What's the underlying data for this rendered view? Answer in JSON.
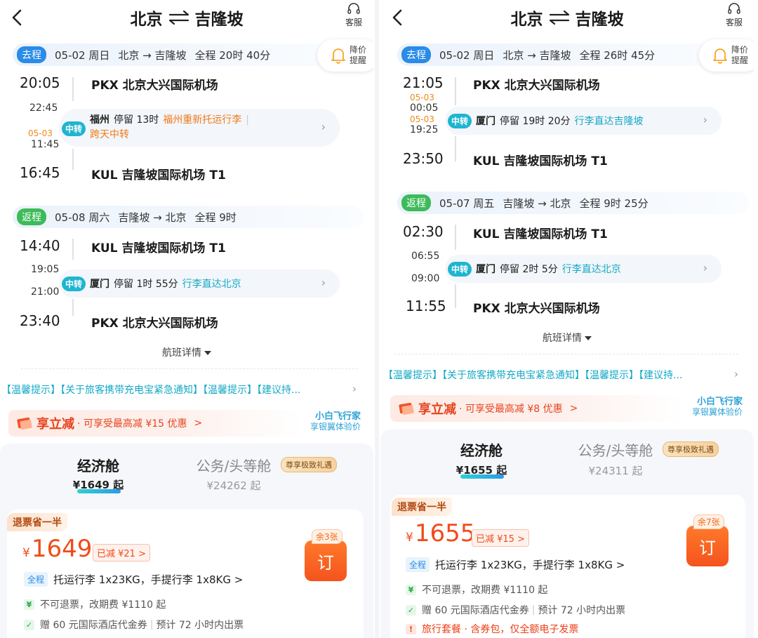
{
  "left": {
    "title": {
      "from": "北京",
      "to": "吉隆坡"
    },
    "service_label": "客服",
    "alert_label_1": "降价",
    "alert_label_2": "提醒",
    "outbound": {
      "tag": "去程",
      "date": "05-02 周日",
      "route": "北京 → 吉隆坡",
      "duration": "全程 20时 40分",
      "dep_time": "20:05",
      "dep_airport": "PKX 北京大兴国际机场",
      "stop_arrive": "22:45",
      "stop_depart_date": "05-03",
      "stop_depart": "11:45",
      "transfer_badge": "中转",
      "stop_city": "福州",
      "stop_duration": "停留 13时",
      "stop_note": "福州重新托运行李",
      "stop_note2": "跨天中转",
      "arr_time": "16:45",
      "arr_airport": "KUL 吉隆坡国际机场 T1"
    },
    "return": {
      "tag": "返程",
      "date": "05-08 周六",
      "route": "吉隆坡 → 北京",
      "duration": "全程 9时",
      "dep_time": "14:40",
      "dep_airport": "KUL 吉隆坡国际机场 T1",
      "stop_arrive": "19:05",
      "stop_depart": "21:00",
      "transfer_badge": "中转",
      "stop_city": "厦门",
      "stop_duration": "停留 1时 55分",
      "stop_note": "行李直达北京",
      "arr_time": "23:40",
      "arr_airport": "PKX 北京大兴国际机场"
    },
    "details_link": "航班详情",
    "notice": "【温馨提示】【关于旅客携带充电宝紧急通知】【温馨提示】【建议持...",
    "promo": {
      "title": "享立减",
      "text": "· 可享受最高减 ¥15 优惠",
      "arrow": ">",
      "side1": "小白飞行家",
      "side2": "享银翼体验价"
    },
    "cabins": {
      "economy": "经济舱",
      "economy_price": "¥1649 起",
      "business": "公务/头等舱",
      "vip": "尊享极致礼遇",
      "business_price": "¥24262 起"
    },
    "offer": {
      "refund_tag": "退票省一半",
      "currency": "¥",
      "price": "1649",
      "discount": "已减 ¥21 >",
      "remain": "余3张",
      "book": "订",
      "baggage_tag": "全程",
      "baggage": "托运行李 1x23KG，手提行李 1x8KG >",
      "rule1": "不可退票，改期费 ¥1110 起",
      "rule2a": "赠 60 元国际酒店代金券",
      "rule2b": "预计 72 小时内出票"
    }
  },
  "right": {
    "title": {
      "from": "北京",
      "to": "吉隆坡"
    },
    "service_label": "客服",
    "alert_label_1": "降价",
    "alert_label_2": "提醒",
    "outbound": {
      "tag": "去程",
      "date": "05-02 周日",
      "route": "北京 → 吉隆坡",
      "duration": "全程 26时 45分",
      "dep_time": "21:05",
      "dep_airport": "PKX 北京大兴国际机场",
      "stop_arrive_date": "05-03",
      "stop_arrive": "00:05",
      "stop_depart_date": "05-03",
      "stop_depart": "19:25",
      "transfer_badge": "中转",
      "stop_city": "厦门",
      "stop_duration": "停留 19时 20分",
      "stop_note": "行李直达吉隆坡",
      "arr_time": "23:50",
      "arr_airport": "KUL 吉隆坡国际机场 T1"
    },
    "return": {
      "tag": "返程",
      "date": "05-07 周五",
      "route": "吉隆坡 → 北京",
      "duration": "全程 9时 25分",
      "dep_time": "02:30",
      "dep_airport": "KUL 吉隆坡国际机场 T1",
      "stop_arrive": "06:55",
      "stop_depart": "09:00",
      "transfer_badge": "中转",
      "stop_city": "厦门",
      "stop_duration": "停留 2时 5分",
      "stop_note": "行李直达北京",
      "arr_time": "11:55",
      "arr_airport": "PKX 北京大兴国际机场"
    },
    "details_link": "航班详情",
    "notice": "【温馨提示】【关于旅客携带充电宝紧急通知】【温馨提示】【建议持...",
    "promo": {
      "title": "享立减",
      "text": "· 可享受最高减 ¥8 优惠",
      "arrow": ">",
      "side1": "小白飞行家",
      "side2": "享银翼体验价"
    },
    "cabins": {
      "economy": "经济舱",
      "economy_price": "¥1655 起",
      "business": "公务/头等舱",
      "vip": "尊享极致礼遇",
      "business_price": "¥24311 起"
    },
    "offer": {
      "refund_tag": "退票省一半",
      "currency": "¥",
      "price": "1655",
      "discount": "已减 ¥15 >",
      "remain": "余7张",
      "book": "订",
      "baggage_tag": "全程",
      "baggage": "托运行李 1x23KG，手提行李 1x8KG >",
      "rule1": "不可退票，改期费 ¥1110 起",
      "rule2a": "赠 60 元国际酒店代金券",
      "rule2b": "预计 72 小时内出票",
      "rule3": "旅行套餐 · 含券包，仅全额电子发票"
    }
  }
}
